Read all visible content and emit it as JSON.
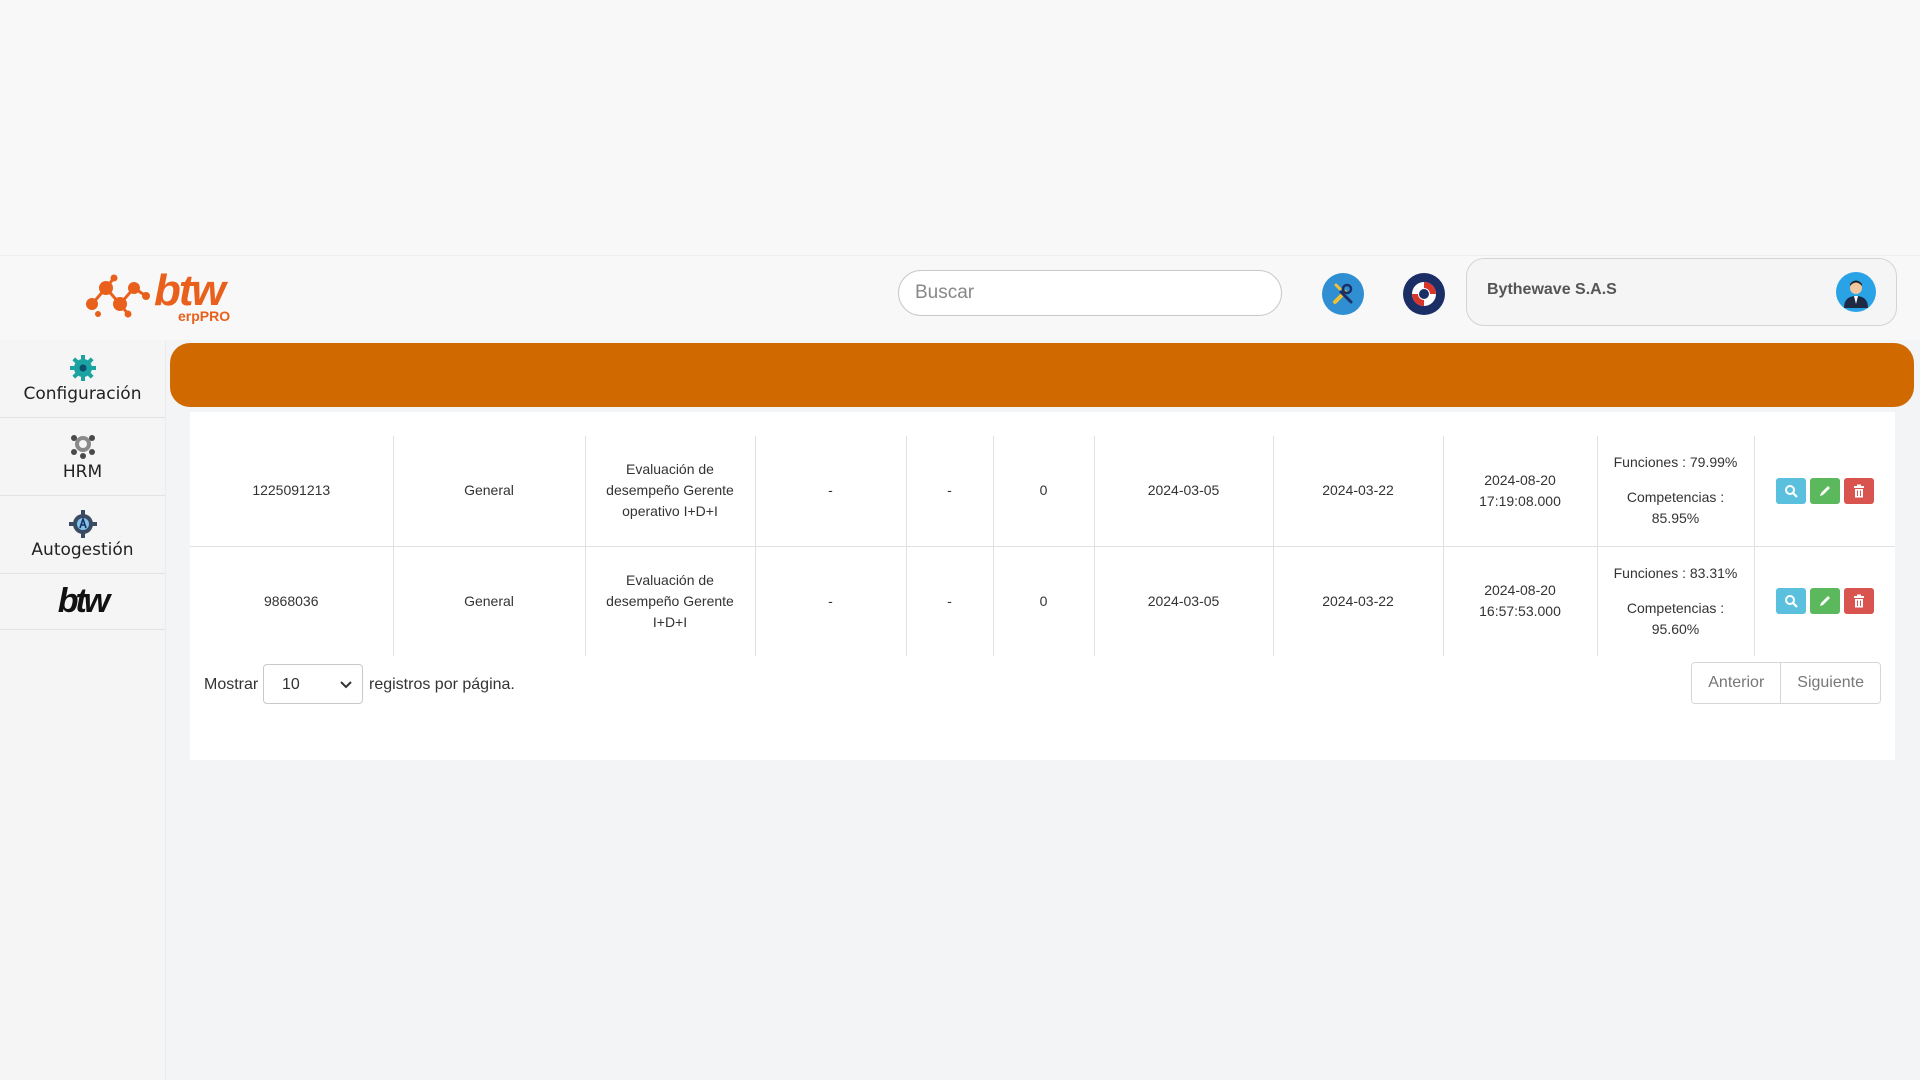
{
  "header": {
    "logo_text": "btw",
    "logo_sub": "erpPRO",
    "search_placeholder": "Buscar",
    "company": "Bythewave S.A.S"
  },
  "icons": {
    "tools": "tools-icon",
    "help": "lifebuoy-icon",
    "user": "user-avatar-icon",
    "config": "gear-icon",
    "hrm": "people-gear-icon",
    "auto": "auto-gear-icon"
  },
  "colors": {
    "accent": "#d06a00",
    "brand": "#e8601c",
    "view": "#5bc0de",
    "edit": "#5cb85c",
    "delete": "#d9534f"
  },
  "sidebar": {
    "items": [
      {
        "label": "Configuración"
      },
      {
        "label": "HRM"
      },
      {
        "label": "Autogestión"
      }
    ],
    "brand": "btw"
  },
  "table": {
    "rows": [
      {
        "id": "1225091213",
        "type": "General",
        "name": "Evaluación de desempeño Gerente operativo I+D+I",
        "c4": "-",
        "c5": "-",
        "count": "0",
        "start": "2024-03-05",
        "end": "2024-03-22",
        "date": "2024-08-20",
        "time": "17:19:08.000",
        "funciones": "Funciones : 79.99%",
        "competencias": "Competencias :",
        "competencias_val": "85.95%"
      },
      {
        "id": "9868036",
        "type": "General",
        "name": "Evaluación de desempeño Gerente I+D+I",
        "c4": "-",
        "c5": "-",
        "count": "0",
        "start": "2024-03-05",
        "end": "2024-03-22",
        "date": "2024-08-20",
        "time": "16:57:53.000",
        "funciones": "Funciones : 83.31%",
        "competencias": "Competencias :",
        "competencias_val": "95.60%"
      }
    ]
  },
  "pagination": {
    "show_label": "Mostrar",
    "page_size": "10",
    "per_page_label": "registros por página.",
    "prev": "Anterior",
    "next": "Siguiente"
  }
}
